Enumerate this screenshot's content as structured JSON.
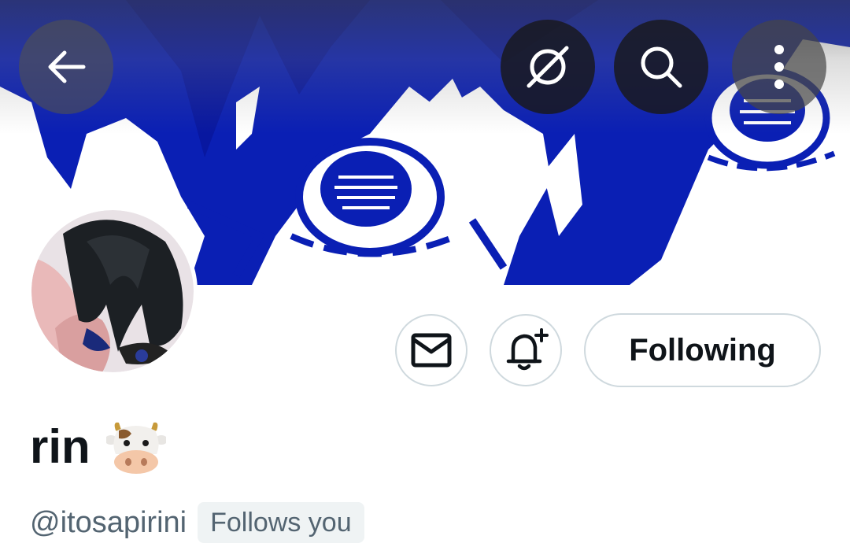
{
  "header": {
    "back_icon": "arrow-left-icon",
    "grok_icon": "grok-icon",
    "search_icon": "search-icon",
    "more_icon": "more-vertical-icon"
  },
  "banner": {
    "accent_color": "#0a1fb4"
  },
  "profile": {
    "display_name": "rin",
    "name_emoji": "cow-face-emoji",
    "handle": "@itosapirini",
    "follows_you_label": "Follows you"
  },
  "actions": {
    "message_icon": "envelope-icon",
    "notify_icon": "bell-plus-icon",
    "following_label": "Following"
  },
  "colors": {
    "text_primary": "#0f1419",
    "text_secondary": "#536471",
    "border": "#cfd9de",
    "badge_bg": "#eff3f4"
  }
}
